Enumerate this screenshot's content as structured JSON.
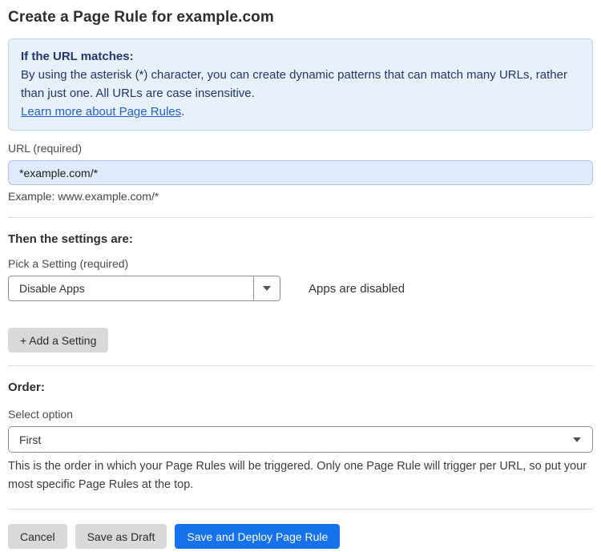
{
  "page": {
    "title": "Create a Page Rule for example.com"
  },
  "info_box": {
    "heading": "If the URL matches:",
    "body": "By using the asterisk (*) character, you can create dynamic patterns that can match many URLs, rather than just one. All URLs are case insensitive.",
    "link_label": "Learn more about Page Rules",
    "link_suffix": "."
  },
  "url_field": {
    "label": "URL (required)",
    "value": "*example.com/*",
    "example": "Example: www.example.com/*"
  },
  "settings_section": {
    "heading": "Then the settings are:",
    "picker_label": "Pick a Setting (required)",
    "selected_setting": "Disable Apps",
    "status_text": "Apps are disabled",
    "add_setting_label": "+ Add a Setting"
  },
  "order_section": {
    "heading": "Order:",
    "select_label": "Select option",
    "selected_option": "First",
    "help_text": "This is the order in which your Page Rules will be triggered. Only one Page Rule will trigger per URL, so put your most specific Page Rules at the top."
  },
  "footer": {
    "cancel_label": "Cancel",
    "save_draft_label": "Save as Draft",
    "save_deploy_label": "Save and Deploy Page Rule"
  },
  "colors": {
    "info_box_bg": "#e8f1fb",
    "info_box_border": "#b9d4f1",
    "info_box_text": "#23366e",
    "link_blue": "#2261c5",
    "url_input_bg": "#dfeafa",
    "url_input_border": "#a9c6e8",
    "primary_button_bg": "#1672ec",
    "secondary_button_bg": "#d9d9d9"
  },
  "icons": {
    "dropdown_caret": "triangle-down"
  }
}
